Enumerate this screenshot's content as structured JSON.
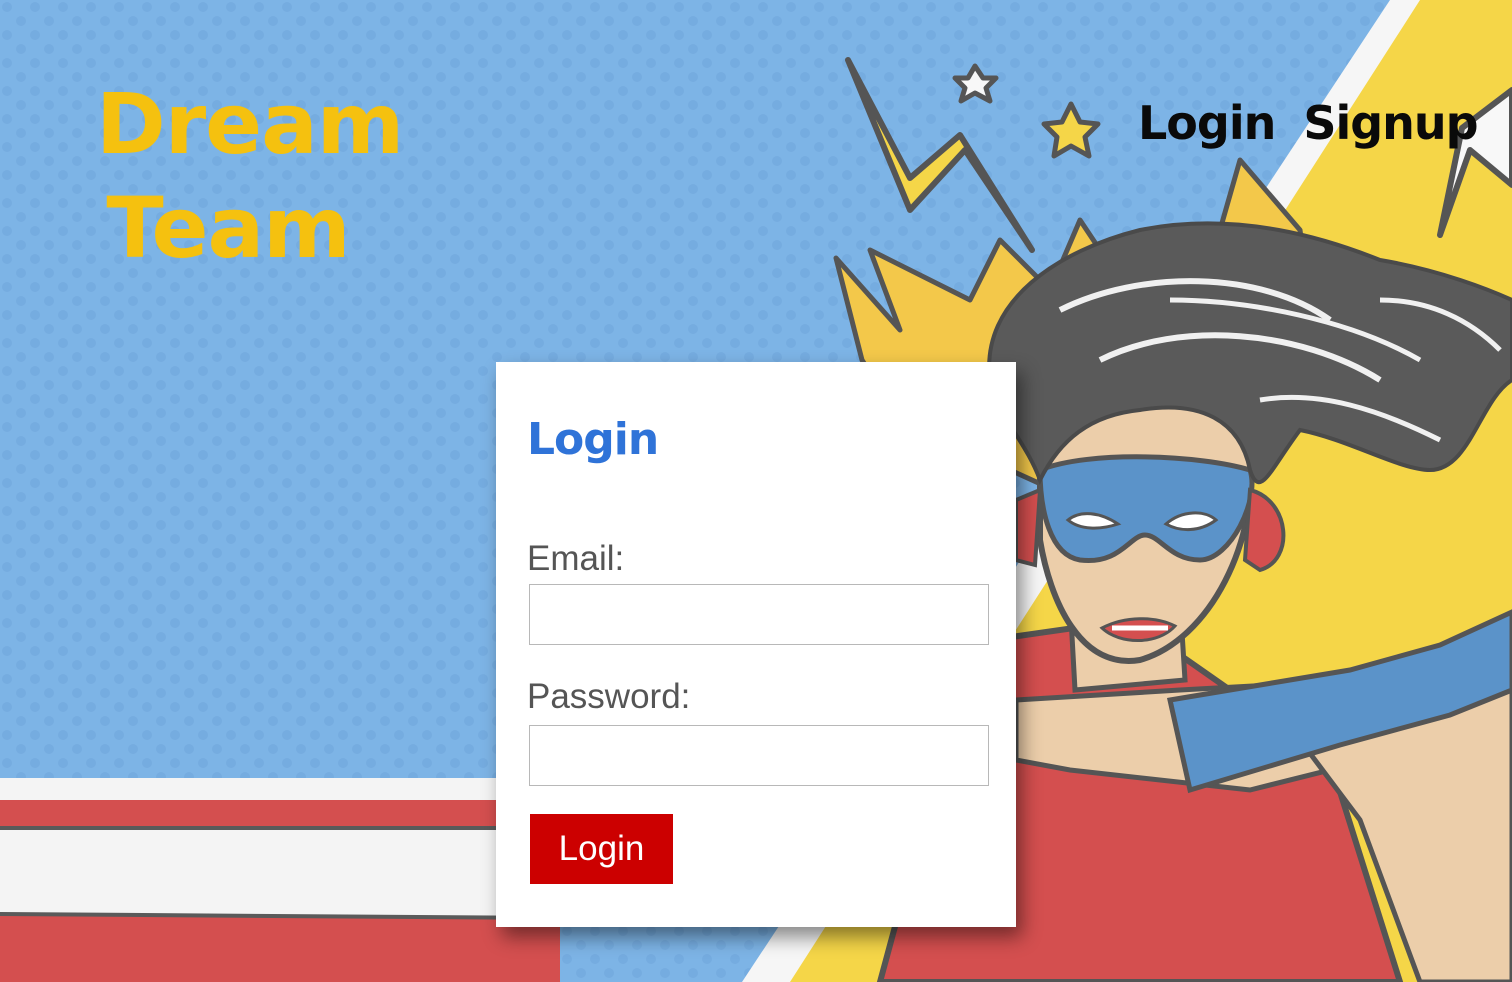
{
  "brand": {
    "line1": "Dream",
    "line2": "Team"
  },
  "nav": {
    "login_label": "Login",
    "signup_label": "Signup"
  },
  "login_card": {
    "title": "Login",
    "email_label": "Email:",
    "email_value": "",
    "password_label": "Password:",
    "password_value": "",
    "submit_label": "Login"
  },
  "icons": {
    "hero": "superhero-woman-illustration",
    "stars": "star-icon",
    "lightning": "lightning-bolt-icon"
  },
  "colors": {
    "brand": "#f5c10f",
    "nav_text": "#0a0a0a",
    "card_title": "#2f73d8",
    "button_bg": "#cc0000",
    "sky": "#7db4e6",
    "yellow_panel": "#f5d648",
    "stripe_red": "#d44f4f",
    "mask_blue": "#5b93c9",
    "skin": "#ecceaa"
  }
}
